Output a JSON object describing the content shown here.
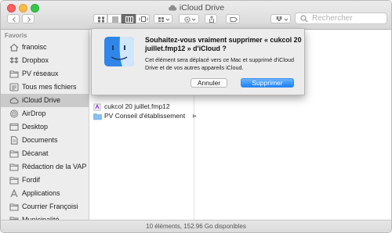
{
  "window": {
    "title": "iCloud Drive",
    "status": "10 éléments, 152.96 Go disponibles"
  },
  "toolbar": {
    "search_placeholder": "Rechercher",
    "view_mode_selected": "columns"
  },
  "sidebar": {
    "header": "Favoris",
    "items": [
      {
        "label": "franoisc",
        "icon": "house-icon"
      },
      {
        "label": "Dropbox",
        "icon": "dropbox-icon"
      },
      {
        "label": "PV réseaux",
        "icon": "folder-icon"
      },
      {
        "label": "Tous mes fichiers",
        "icon": "all-files-icon"
      },
      {
        "label": "iCloud Drive",
        "icon": "cloud-icon",
        "selected": true
      },
      {
        "label": "AirDrop",
        "icon": "airdrop-icon"
      },
      {
        "label": "Desktop",
        "icon": "desktop-icon"
      },
      {
        "label": "Documents",
        "icon": "documents-icon"
      },
      {
        "label": "Décanat",
        "icon": "folder-icon"
      },
      {
        "label": "Rédaction de la VAP",
        "icon": "folder-icon"
      },
      {
        "label": "Fordif",
        "icon": "folder-icon"
      },
      {
        "label": "Applications",
        "icon": "applications-icon"
      },
      {
        "label": "Courrier Françoisi",
        "icon": "folder-icon"
      },
      {
        "label": "Municipalité",
        "icon": "folder-icon"
      }
    ]
  },
  "files": [
    {
      "name": "cukcol 20 juillet.fmp12",
      "icon": "filemaker-icon"
    },
    {
      "name": "PV Conseil d'établissement",
      "icon": "folder-icon"
    }
  ],
  "dialog": {
    "title": "Souhaitez-vous vraiment supprimer « cukcol 20 juillet.fmp12 » d'iCloud ?",
    "message": "Cet élément sera déplacé vers ce Mac et supprimé d'iCloud Drive et de vos autres appareils iCloud.",
    "cancel_label": "Annuler",
    "confirm_label": "Supprimer"
  },
  "colors": {
    "accent": "#1a82fb",
    "sidebar_bg": "#ededed",
    "sidebar_selected": "#cacaca",
    "close": "#fc605c",
    "minimize": "#fdbc40",
    "maximize": "#34c84a"
  }
}
